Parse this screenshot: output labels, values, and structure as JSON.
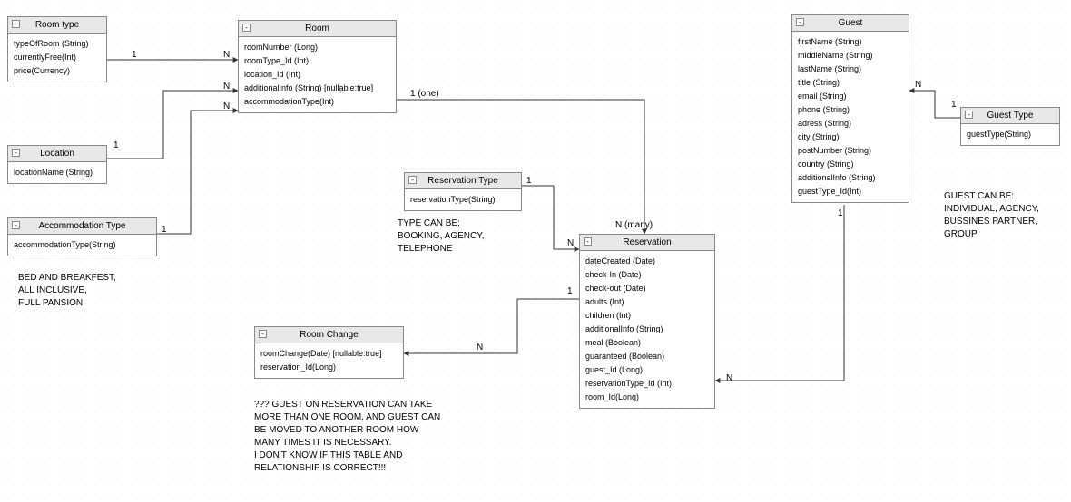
{
  "entities": {
    "roomType": {
      "title": "Room type",
      "attrs": [
        "typeOfRoom (String)",
        "currentlyFree(Int)",
        "price(Currency)"
      ]
    },
    "location": {
      "title": "Location",
      "attrs": [
        "locationName (String)"
      ]
    },
    "accommodationType": {
      "title": "Accommodation Type",
      "attrs": [
        "accommodationType(String)"
      ]
    },
    "room": {
      "title": "Room",
      "attrs": [
        "roomNumber (Long)",
        "roomType_Id (Int)",
        "location_Id (Int)",
        "additionalInfo (String) [nullable:true]",
        "accommodationType(Int)"
      ]
    },
    "reservationType": {
      "title": "Reservation Type",
      "attrs": [
        "reservationType(String)"
      ]
    },
    "roomChange": {
      "title": "Room Change",
      "attrs": [
        "roomChange(Date) [nullable:true]",
        "reservation_Id(Long)"
      ]
    },
    "reservation": {
      "title": "Reservation",
      "attrs": [
        "dateCreated (Date)",
        "check-In (Date)",
        "check-out (Date)",
        "adults (Int)",
        "children (Int)",
        "additionalInfo (String)",
        "meal (Boolean)",
        "guaranteed (Boolean)",
        "guest_Id (Long)",
        "reservationType_Id (Int)",
        "room_Id(Long)"
      ]
    },
    "guest": {
      "title": "Guest",
      "attrs": [
        "firstName (String)",
        "middleName (String)",
        "lastName (String)",
        "title (String)",
        "email (String)",
        "phone (String)",
        "adress (String)",
        "city (String)",
        "postNumber (String)",
        "country (String)",
        "additionalInfo (String)",
        "guestType_Id(Int)"
      ]
    },
    "guestType": {
      "title": "Guest Type",
      "attrs": [
        "guestType(String)"
      ]
    }
  },
  "notes": {
    "accomNote": "BED AND BREAKFEST,\nALL INCLUSIVE,\nFULL PANSION",
    "resTypeNote": "TYPE CAN BE:\nBOOKING, AGENCY,\nTELEPHONE",
    "roomChangeNote": "??? GUEST ON RESERVATION CAN TAKE\nMORE THAN ONE ROOM, AND GUEST CAN\nBE MOVED TO ANOTHER ROOM HOW\nMANY TIMES IT IS NECESSARY.\nI DON'T KNOW IF THIS TABLE AND\nRELATIONSHIP IS CORRECT!!!",
    "guestTypeNote": "GUEST CAN BE:\nINDIVIDUAL, AGENCY,\nBUSSINES PARTNER,\nGROUP"
  },
  "cardinalities": {
    "roomType_room_1": "1",
    "roomType_room_N": "N",
    "location_room_1": "1",
    "location_room_N": "N",
    "accom_room_1": "1",
    "accom_room_N": "N",
    "room_res_1": "1  (one)",
    "room_res_N": "N  (many)",
    "resType_res_1": "1",
    "resType_res_N": "N",
    "roomChange_res_N": "N",
    "roomChange_res_1": "1",
    "guest_res_1": "1",
    "guest_res_N": "N",
    "guestType_guest_1": "1",
    "guestType_guest_N": "N"
  },
  "collapse": "-"
}
